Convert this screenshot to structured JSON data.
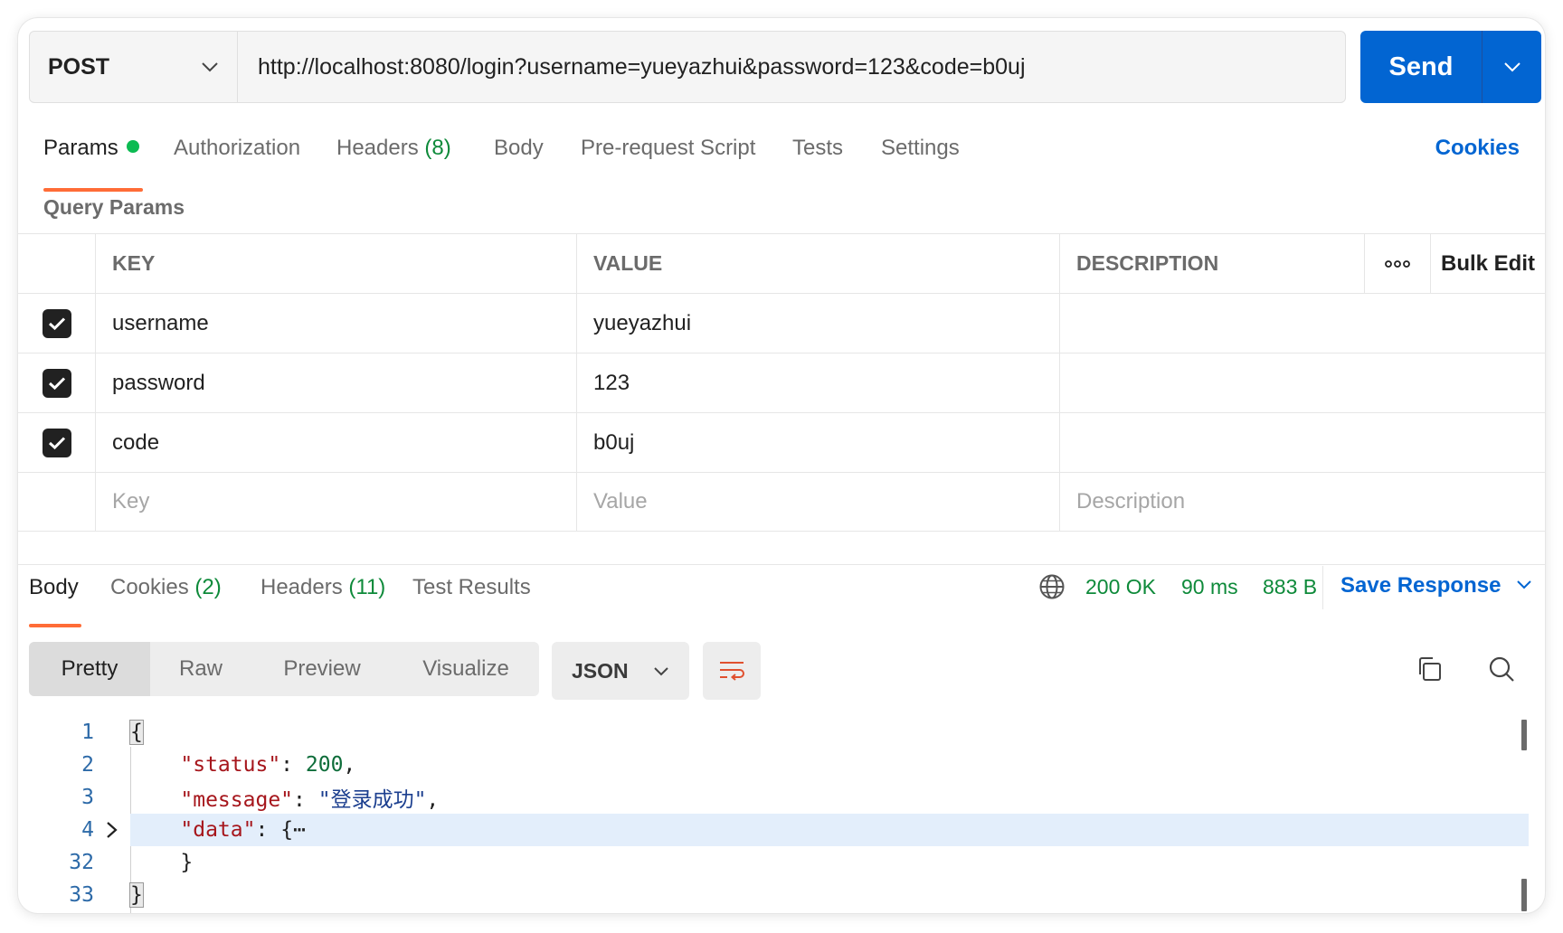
{
  "request": {
    "method": "POST",
    "url": "http://localhost:8080/login?username=yueyazhui&password=123&code=b0uj",
    "send_label": "Send"
  },
  "request_tabs": [
    {
      "label": "Params",
      "count": ""
    },
    {
      "label": "Authorization",
      "count": ""
    },
    {
      "label": "Headers",
      "count": "(8)"
    },
    {
      "label": "Body",
      "count": ""
    },
    {
      "label": "Pre-request Script",
      "count": ""
    },
    {
      "label": "Tests",
      "count": ""
    },
    {
      "label": "Settings",
      "count": ""
    }
  ],
  "cookies_link": "Cookies",
  "query_params": {
    "title": "Query Params",
    "headers": {
      "key": "KEY",
      "value": "VALUE",
      "description": "DESCRIPTION",
      "bulk_edit": "Bulk Edit"
    },
    "rows": [
      {
        "key": "username",
        "value": "yueyazhui",
        "description": ""
      },
      {
        "key": "password",
        "value": "123",
        "description": ""
      },
      {
        "key": "code",
        "value": "b0uj",
        "description": ""
      }
    ],
    "placeholders": {
      "key": "Key",
      "value": "Value",
      "description": "Description"
    }
  },
  "response": {
    "tabs": [
      {
        "label": "Body",
        "count": ""
      },
      {
        "label": "Cookies",
        "count": "(2)"
      },
      {
        "label": "Headers",
        "count": "(11)"
      },
      {
        "label": "Test Results",
        "count": ""
      }
    ],
    "status": "200 OK",
    "time": "90 ms",
    "size": "883 B",
    "save_label": "Save Response",
    "view_modes": [
      "Pretty",
      "Raw",
      "Preview",
      "Visualize"
    ],
    "format": "JSON",
    "lines": [
      {
        "num": "1"
      },
      {
        "num": "2",
        "key": "\"status\"",
        "value": "200"
      },
      {
        "num": "3",
        "key": "\"message\"",
        "value": "\"登录成功\""
      },
      {
        "num": "4",
        "key": "\"data\"",
        "value": "{⋯"
      },
      {
        "num": "32",
        "value": "}"
      },
      {
        "num": "33"
      }
    ]
  },
  "colors": {
    "accent": "#ff6c37",
    "send": "#0265d2",
    "ok": "#0e8a3a",
    "json_key": "#a6161c",
    "json_string": "#1c3f8f"
  },
  "icons": [
    "chevron-down-icon",
    "check-icon",
    "more-icon",
    "globe-icon",
    "wrap-icon",
    "copy-icon",
    "search-icon",
    "chevron-right-icon"
  ]
}
